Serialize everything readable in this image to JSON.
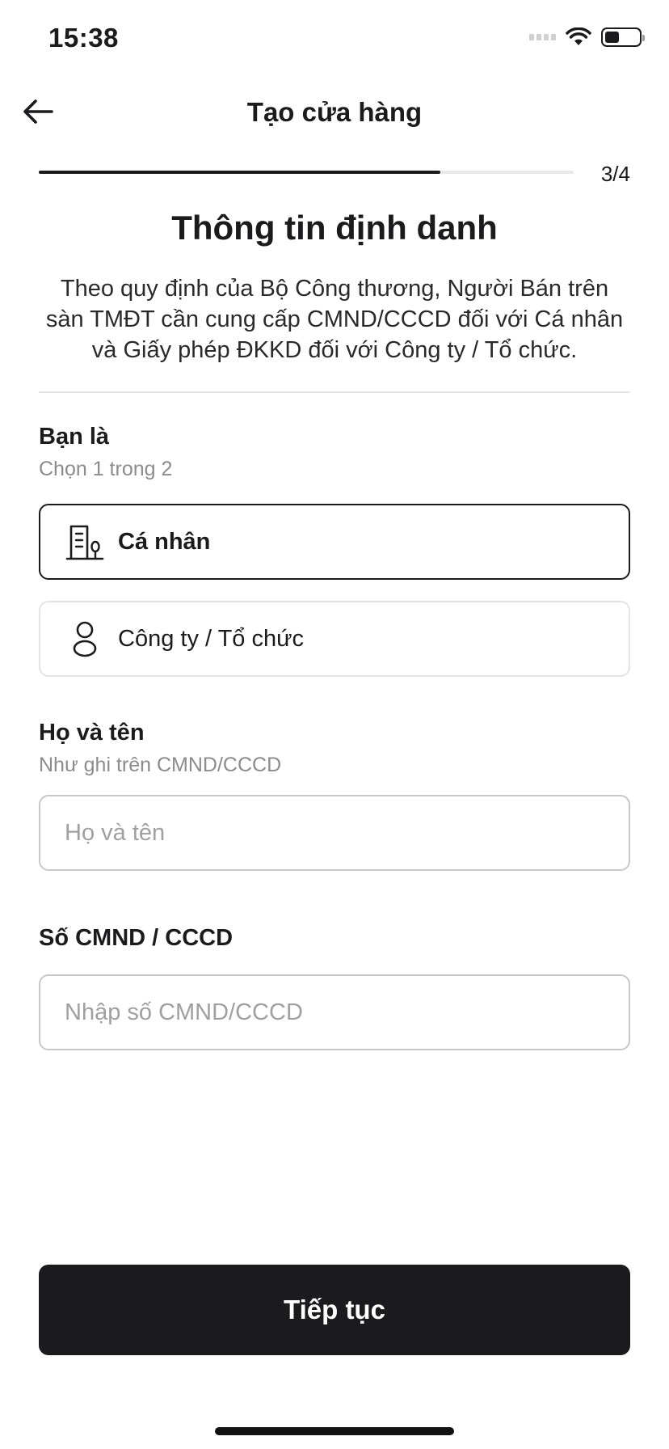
{
  "status_bar": {
    "time": "15:38",
    "icons": [
      "signal-icon",
      "wifi-icon",
      "battery-icon"
    ],
    "battery_level": 0.42
  },
  "header": {
    "back_icon": "arrow-left-icon",
    "title": "Tạo cửa hàng"
  },
  "progress": {
    "step": 3,
    "total": 4,
    "label": "3/4",
    "fraction": 0.75
  },
  "section": {
    "title": "Thông tin định danh",
    "description": "Theo quy định của Bộ Công thương, Người Bán trên sàn TMĐT cần cung cấp CMND/CCCD đối với Cá nhân và Giấy phép ĐKKD đối với Công ty / Tổ chức."
  },
  "seller_type": {
    "label": "Bạn là",
    "hint": "Chọn 1 trong 2",
    "options": [
      {
        "label": "Cá nhân",
        "icon": "building-icon",
        "selected": true
      },
      {
        "label": "Công ty / Tổ chức",
        "icon": "person-icon",
        "selected": false
      }
    ]
  },
  "full_name": {
    "label": "Họ và tên",
    "hint": "Như ghi trên CMND/CCCD",
    "value": "",
    "placeholder": "Họ và tên"
  },
  "id_number": {
    "label": "Số CMND / CCCD",
    "value": "",
    "placeholder": "Nhập số CMND/CCCD"
  },
  "actions": {
    "continue_label": "Tiếp tục"
  },
  "colors": {
    "primary": "#1b1b1d",
    "progress_track": "#e9e9e9",
    "hint_text": "#8c8c8c",
    "input_border": "#c8c8c8"
  }
}
